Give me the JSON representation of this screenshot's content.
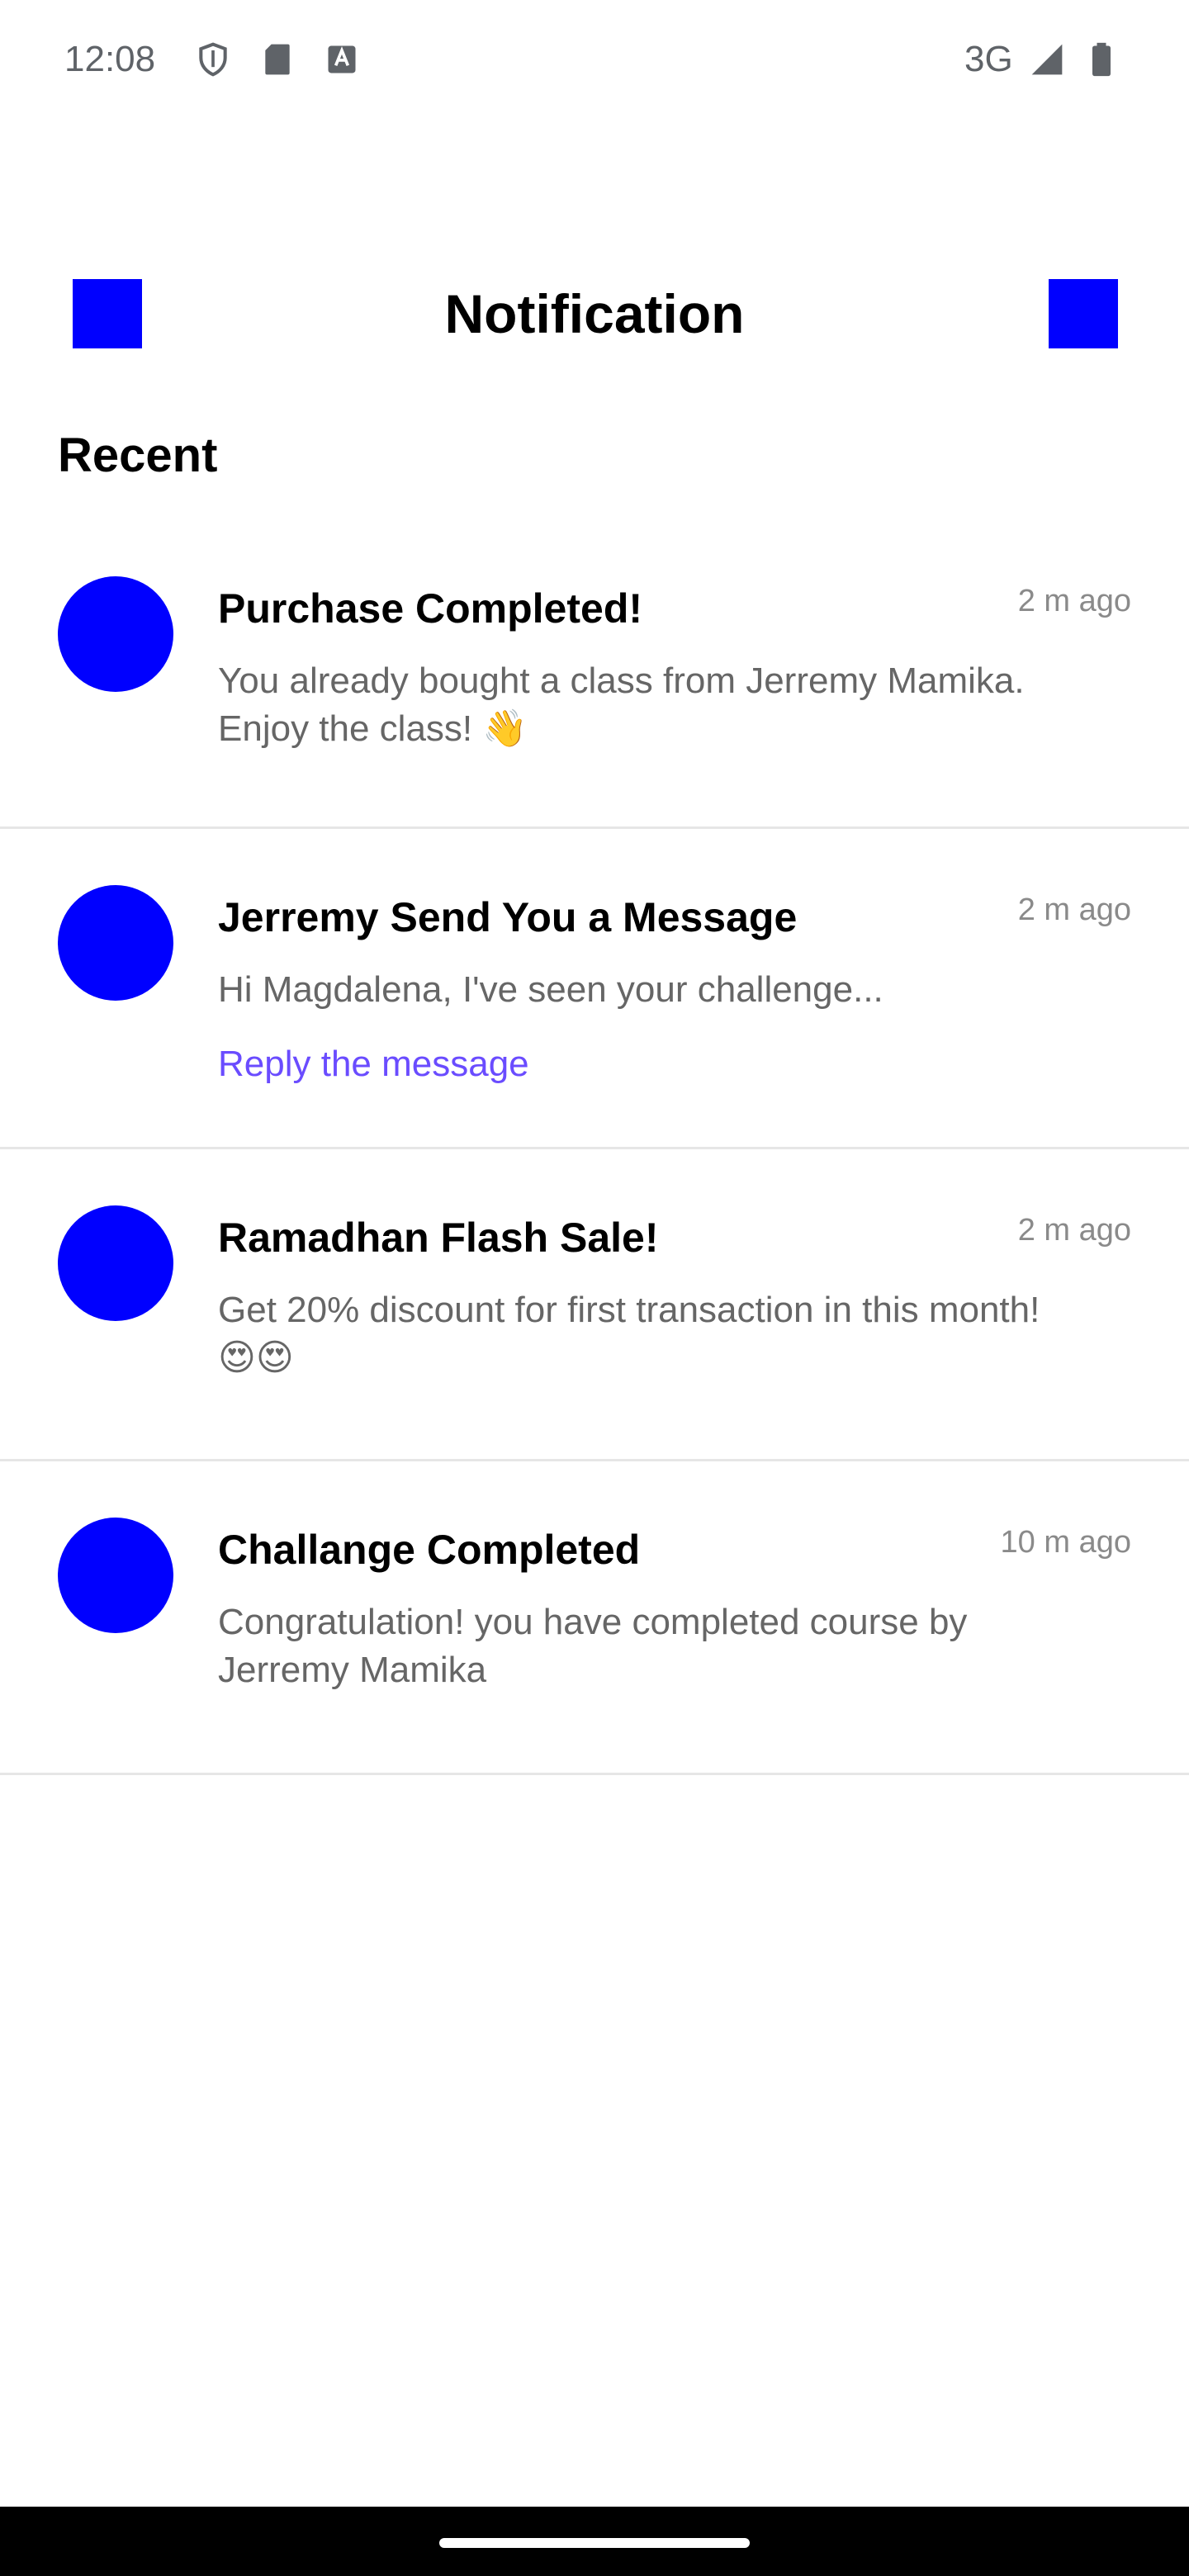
{
  "status_bar": {
    "time": "12:08",
    "network": "3G",
    "icons": [
      "shield-icon",
      "sd-card-icon",
      "keyboard-a-icon",
      "signal-icon",
      "battery-icon"
    ]
  },
  "header": {
    "title": "Notification",
    "back_icon": "square-placeholder-icon",
    "action_icon": "square-placeholder-icon"
  },
  "section": {
    "title": "Recent"
  },
  "notifications": [
    {
      "title": "Purchase Completed!",
      "time": "2 m ago",
      "body": "You already bought a class from Jerremy Mamika. Enjoy the class! 👋"
    },
    {
      "title": "Jerremy Send You a Message",
      "time": "2 m ago",
      "body": "Hi Magdalena, I've seen your challenge...",
      "link": "Reply the message"
    },
    {
      "title": "Ramadhan Flash Sale!",
      "time": "2 m ago",
      "body": "Get 20% discount for first transaction in this month!😍😍"
    },
    {
      "title": "Challange Completed",
      "time": "10 m ago",
      "body": "Congratulation! you have completed course by Jerremy Mamika"
    }
  ],
  "colors": {
    "accent": "#0000ff",
    "link": "#6a4cff",
    "muted_text": "#666666",
    "divider": "#e6e6e6"
  }
}
